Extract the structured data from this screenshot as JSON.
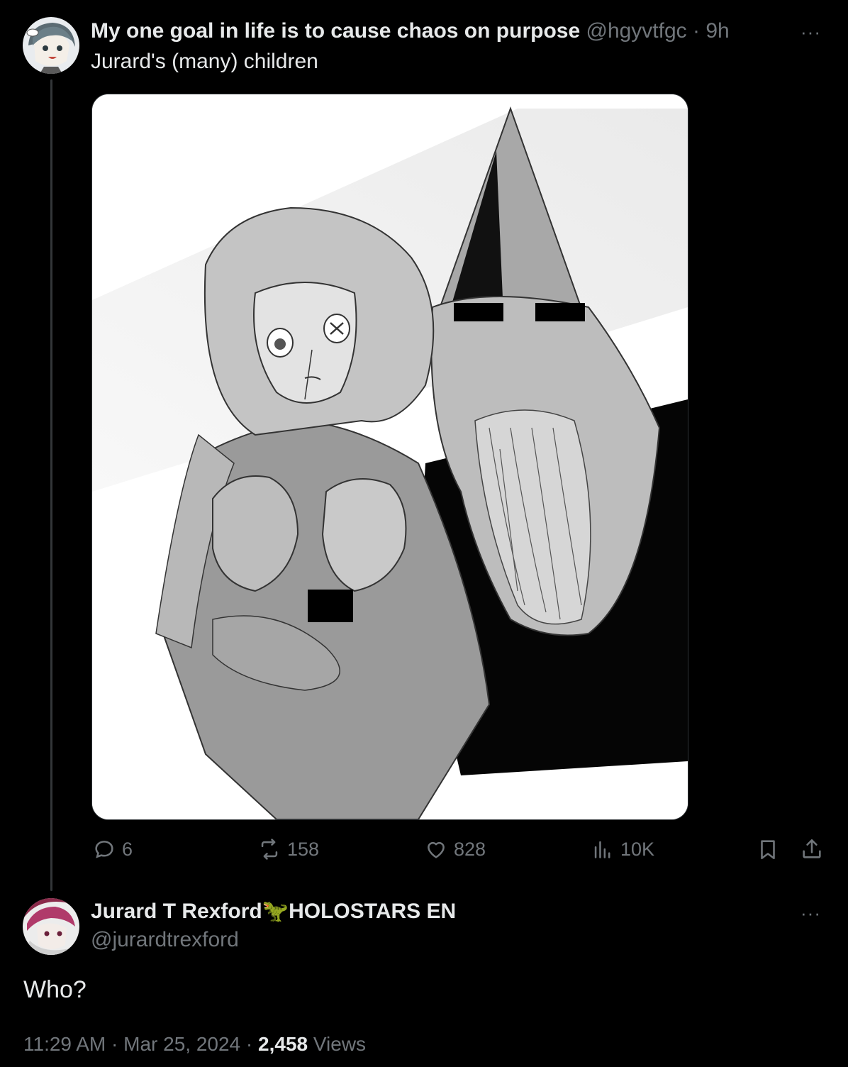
{
  "original_tweet": {
    "display_name": "My one goal in life is to cause chaos on purpose",
    "handle": "@hgyvtfgc",
    "separator": "·",
    "time": "9h",
    "text": "Jurard's (many) children",
    "more_label": "···",
    "avatar_icon": "anime-avatar-icon",
    "stats": {
      "replies": "6",
      "reposts": "158",
      "likes": "828",
      "views": "10K"
    }
  },
  "reply_tweet": {
    "display_name": "Jurard T Rexford",
    "name_emoji": "🦖",
    "name_suffix": "HOLOSTARS EN",
    "handle": "@jurardtrexford",
    "more_label": "···",
    "text": "Who?",
    "time": "11:29 AM",
    "date": "Mar 25, 2024",
    "views_count": "2,458",
    "views_label": "Views",
    "separator": "·"
  },
  "colors": {
    "background": "#000000",
    "text_primary": "#e7e9ea",
    "text_muted": "#71767b",
    "thread_line": "#333639",
    "emoji_green": "#6fbf3f"
  }
}
